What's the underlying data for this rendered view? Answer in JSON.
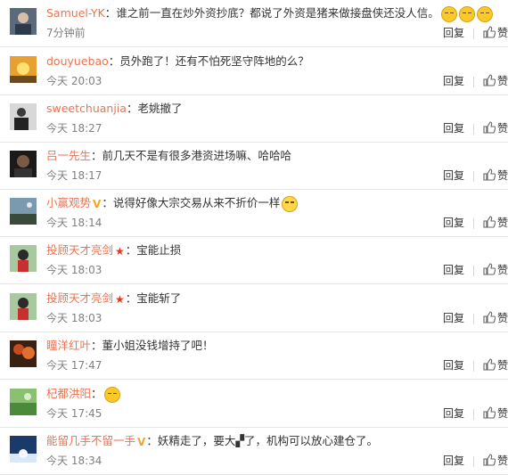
{
  "comments": [
    {
      "user": "Samuel-YK",
      "badge": "",
      "text": "谁之前一直在炒外资抄底？都说了外资是猪来做接盘侠还没人信。",
      "emojis": 3,
      "emoji_style": "smirk",
      "time": "7分钟前",
      "reply": "回复",
      "like": "赞"
    },
    {
      "user": "douyuebao",
      "badge": "",
      "text": "员外跑了！还有不怕死坚守阵地的么？",
      "emojis": 0,
      "emoji_style": "",
      "time": "今天 20:03",
      "reply": "回复",
      "like": "赞"
    },
    {
      "user": "sweetchuanjia",
      "badge": "",
      "text": "老姚撤了",
      "emojis": 0,
      "emoji_style": "",
      "time": "今天 18:27",
      "reply": "回复",
      "like": "赞"
    },
    {
      "user": "吕一先生",
      "badge": "",
      "text": "前几天不是有很多港资进场嘛、哈哈哈",
      "emojis": 0,
      "emoji_style": "",
      "time": "今天 18:17",
      "reply": "回复",
      "like": "赞"
    },
    {
      "user": "小赢观势",
      "badge": "V",
      "text": "说得好像大宗交易从来不折价一样",
      "emojis": 1,
      "emoji_style": "laugh",
      "time": "今天 18:14",
      "reply": "回复",
      "like": "赞"
    },
    {
      "user": "投顾天才亮剑",
      "badge": "★",
      "text": "宝能止损",
      "emojis": 0,
      "emoji_style": "",
      "time": "今天 18:03",
      "reply": "回复",
      "like": "赞"
    },
    {
      "user": "投顾天才亮剑",
      "badge": "★",
      "text": "宝能斩了",
      "emojis": 0,
      "emoji_style": "",
      "time": "今天 18:03",
      "reply": "回复",
      "like": "赞"
    },
    {
      "user": "瞳洋红叶",
      "badge": "",
      "text": "董小姐没钱增持了吧！",
      "emojis": 0,
      "emoji_style": "",
      "time": "今天 17:47",
      "reply": "回复",
      "like": "赞"
    },
    {
      "user": "杞都洪阳",
      "badge": "",
      "text": "",
      "emojis": 1,
      "emoji_style": "meh",
      "time": "今天 17:45",
      "reply": "回复",
      "like": "赞"
    },
    {
      "user": "能留几手不留一手",
      "badge": "V",
      "text": "妖精走了，要大▞了，机构可以放心建仓了。",
      "emojis": 0,
      "emoji_style": "",
      "time": "今天 18:34",
      "reply": "回复",
      "like": "赞"
    }
  ],
  "colors": {
    "username": "#eb7350",
    "meta": "#808080",
    "badge_v": "#f5a623",
    "badge_star": "#e8361e"
  }
}
